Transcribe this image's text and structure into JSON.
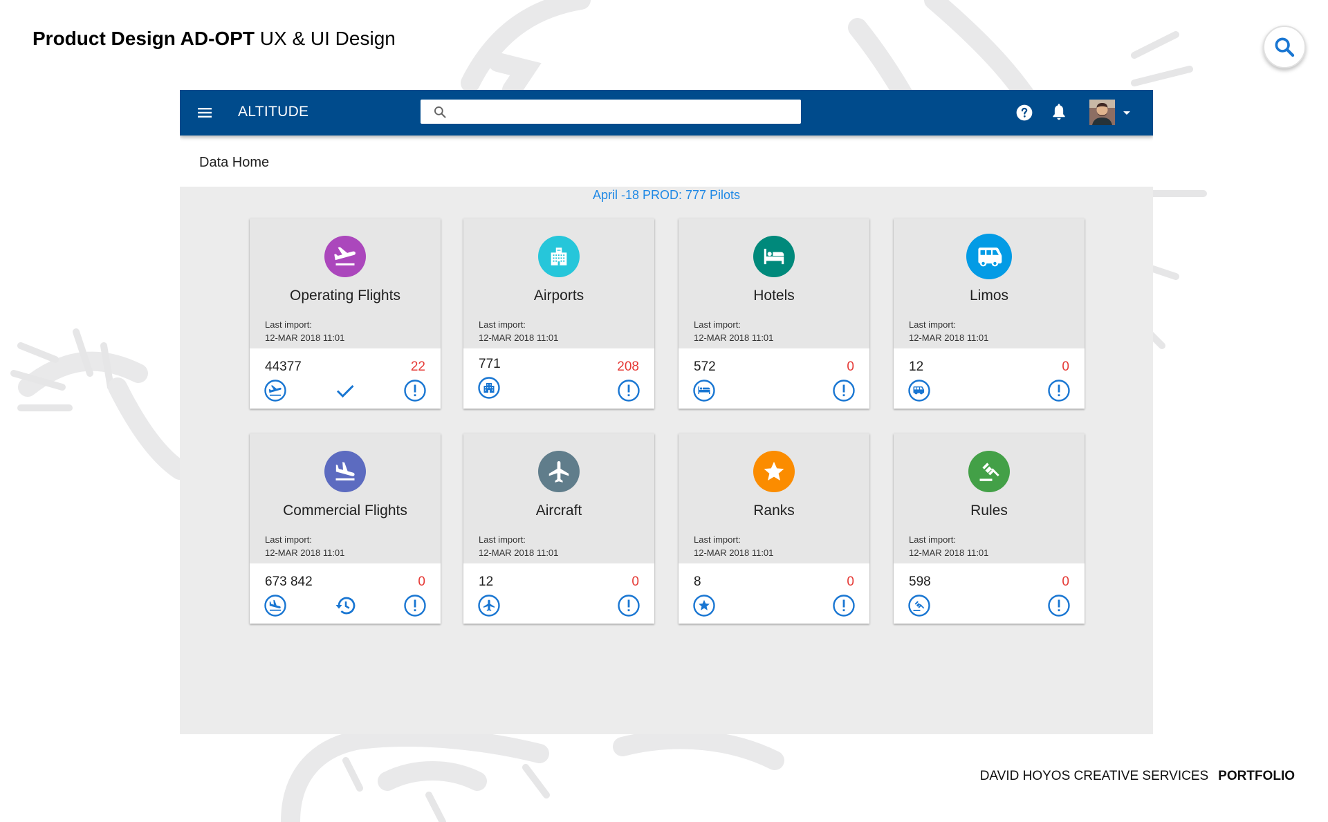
{
  "slide": {
    "title_bold": "Product Design AD-OPT",
    "title_light": " UX & UI Design",
    "footer_studio": "DAVID HOYOS CREATIVE SERVICES",
    "footer_section": "PORTFOLIO"
  },
  "app": {
    "title": "ALTITUDE",
    "search": {
      "value": "",
      "placeholder": ""
    },
    "breadcrumb": "Data Home",
    "dataset_label": "April -18 PROD: 777 Pilots"
  },
  "cards": [
    {
      "title": "Operating Flights",
      "last_import_label": "Last import:",
      "last_import": "12-MAR 2018 11:01",
      "count": "44377",
      "errors": "22",
      "icon": "flight-takeoff-icon",
      "color": "#ab47bc",
      "mid_icon": "check-icon"
    },
    {
      "title": "Airports",
      "last_import_label": "Last import:",
      "last_import": "12-MAR 2018 11:01",
      "count": "771",
      "errors": "208",
      "icon": "building-icon",
      "color": "#26c6da"
    },
    {
      "title": "Hotels",
      "last_import_label": "Last import:",
      "last_import": "12-MAR 2018 11:01",
      "count": "572",
      "errors": "0",
      "icon": "hotel-bed-icon",
      "color": "#00897b"
    },
    {
      "title": "Limos",
      "last_import_label": "Last import:",
      "last_import": "12-MAR 2018 11:01",
      "count": "12",
      "errors": "0",
      "icon": "bus-icon",
      "color": "#039be5"
    },
    {
      "title": "Commercial Flights",
      "last_import_label": "Last import:",
      "last_import": "12-MAR 2018 11:01",
      "count": "673 842",
      "errors": "0",
      "icon": "flight-land-icon",
      "color": "#5c6bc0",
      "mid_icon": "history-icon"
    },
    {
      "title": "Aircraft",
      "last_import_label": "Last import:",
      "last_import": "12-MAR 2018 11:01",
      "count": "12",
      "errors": "0",
      "icon": "airplane-icon",
      "color": "#607d8b"
    },
    {
      "title": "Ranks",
      "last_import_label": "Last import:",
      "last_import": "12-MAR 2018 11:01",
      "count": "8",
      "errors": "0",
      "icon": "star-icon",
      "color": "#fb8c00"
    },
    {
      "title": "Rules",
      "last_import_label": "Last import:",
      "last_import": "12-MAR 2018 11:01",
      "count": "598",
      "errors": "0",
      "icon": "gavel-icon",
      "color": "#43a047"
    }
  ],
  "colors": {
    "topbar": "#004b8c",
    "accent_blue": "#1976d2",
    "error_red": "#e53935",
    "content_bg": "#ececec"
  }
}
